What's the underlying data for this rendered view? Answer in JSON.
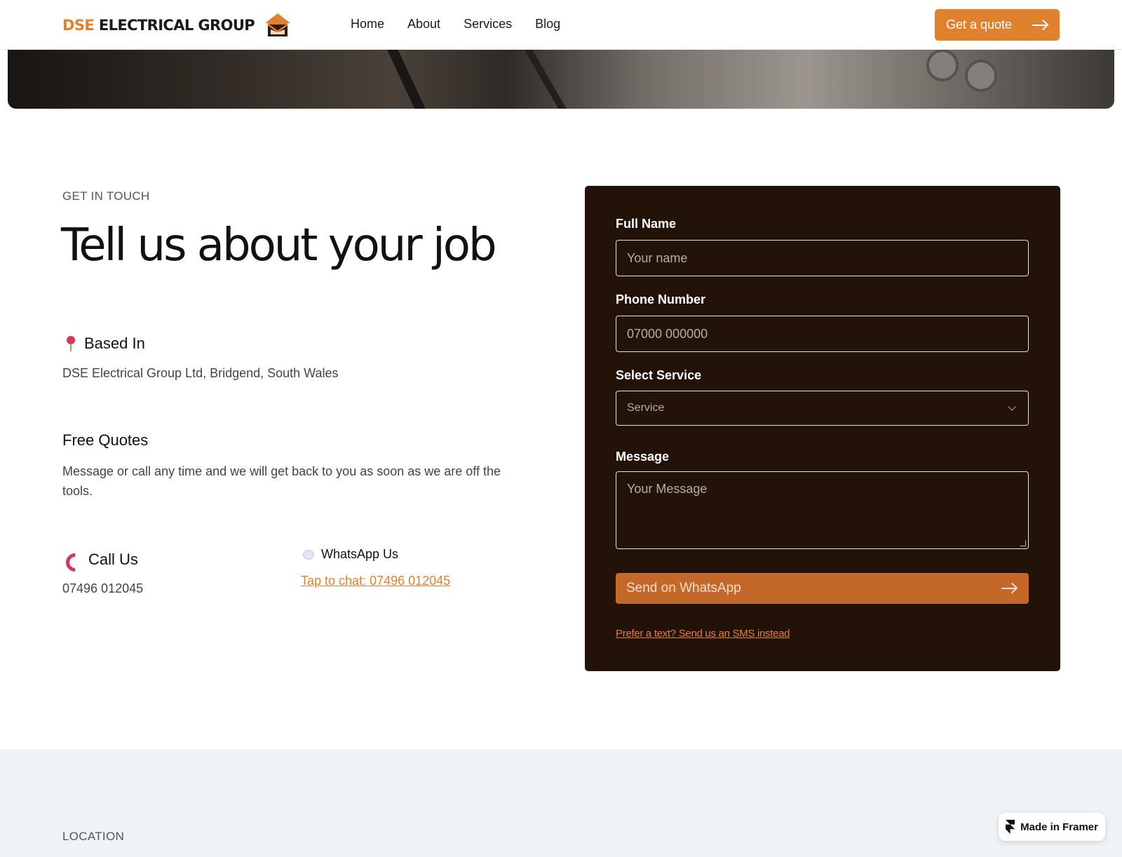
{
  "header": {
    "brand_accent": "DSE",
    "brand_rest": "ELECTRICAL GROUP",
    "logo_icon": "house-envelope-icon",
    "nav": [
      "Home",
      "About",
      "Services",
      "Blog"
    ],
    "cta_label": "Get a quote",
    "cta_icon": "arrow-right-icon"
  },
  "contact": {
    "eyebrow": "GET IN TOUCH",
    "title": "Tell us about your job",
    "based_in": {
      "icon": "pushpin-icon",
      "heading": "Based In",
      "text": "DSE Electrical Group Ltd, Bridgend, South Wales"
    },
    "free_quotes": {
      "heading": "Free Quotes",
      "text": "Message or call any time and we will get back to you as soon as we are off the tools."
    },
    "call": {
      "icon": "phone-icon",
      "heading": "Call Us",
      "number": "07496 012045"
    },
    "whatsapp": {
      "icon": "speech-bubble-icon",
      "heading": "WhatsApp Us",
      "link": "Tap to chat: 07496 012045"
    }
  },
  "form": {
    "name_label": "Full Name",
    "name_placeholder": "Your name",
    "phone_label": "Phone Number",
    "phone_placeholder": "07000 000000",
    "service_label": "Select Service",
    "service_value": "Service",
    "message_label": "Message",
    "message_placeholder": "Your Message",
    "submit_label": "Send on WhatsApp",
    "sms_link": "Prefer a text? Send us an SMS instead"
  },
  "location": {
    "eyebrow": "LOCATION"
  },
  "badge": {
    "label": "Made in Framer"
  },
  "colors": {
    "accent": "#e0812e",
    "form_bg": "#221208",
    "submit_bg": "#c4672a",
    "band_bg": "#f0f3f6"
  }
}
